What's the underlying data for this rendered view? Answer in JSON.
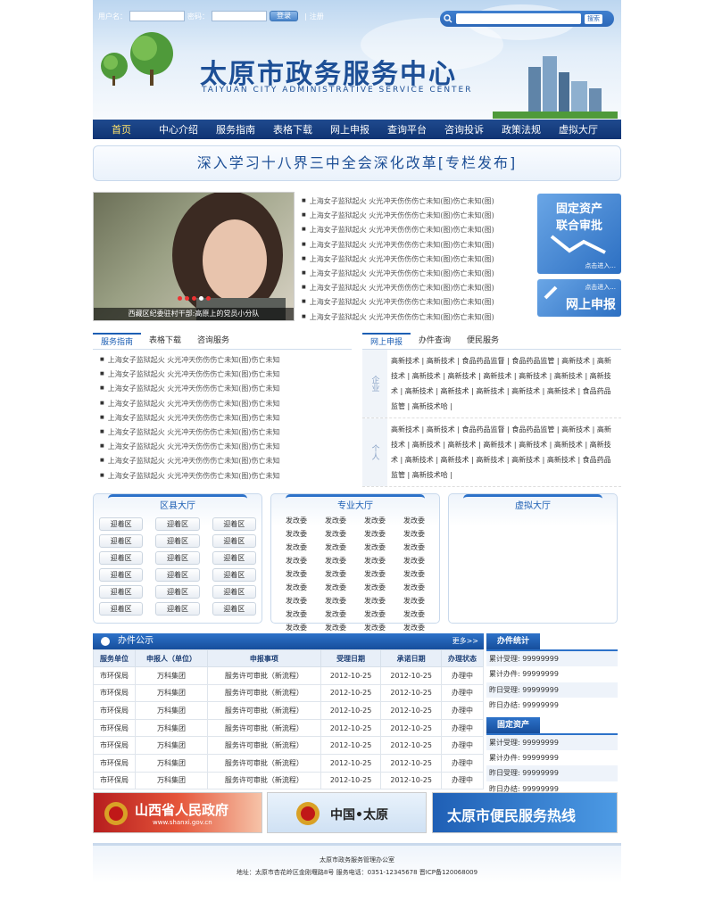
{
  "login": {
    "username_label": "用户名：",
    "password_label": "密码：",
    "login_button": "登录",
    "register_link": "注册"
  },
  "search": {
    "button": "搜索"
  },
  "site": {
    "title": "太原市政务服务中心",
    "subtitle": "TAIYUAN CITY ADMINISTRATIVE SERVICE CENTER"
  },
  "nav": [
    "首页",
    "中心介绍",
    "服务指南",
    "表格下载",
    "网上申报",
    "查询平台",
    "咨询投诉",
    "政策法规",
    "虚拟大厅"
  ],
  "banner": "深入学习十八界三中全会深化改革[专栏发布]",
  "photo_caption": "西藏区纪委驻村干部:高原上的党员小分队",
  "news_items": [
    "上海女子监狱起火 火光冲天伤伤伤亡未知(图)伤亡未知(图)",
    "上海女子监狱起火 火光冲天伤伤伤亡未知(图)伤亡未知(图)",
    "上海女子监狱起火 火光冲天伤伤伤亡未知(图)伤亡未知(图)",
    "上海女子监狱起火 火光冲天伤伤伤亡未知(图)伤亡未知(图)",
    "上海女子监狱起火 火光冲天伤伤伤亡未知(图)伤亡未知(图)",
    "上海女子监狱起火 火光冲天伤伤伤亡未知(图)伤亡未知(图)",
    "上海女子监狱起火 火光冲天伤伤伤亡未知(图)伤亡未知(图)",
    "上海女子监狱起火 火光冲天伤伤伤亡未知(图)伤亡未知(图)",
    "上海女子监狱起火 火光冲天伤伤伤亡未知(图)伤亡未知(图)"
  ],
  "side_buttons": {
    "fixed_assets_line1": "固定资产",
    "fixed_assets_line2": "联合审批",
    "fixed_enter": "点击进入...",
    "online_enter": "点击进入...",
    "online_label": "网上申报"
  },
  "guide_tabs": [
    "服务指南",
    "表格下载",
    "咨询服务"
  ],
  "guide_items": [
    "上海女子监狱起火 火光冲天伤伤伤亡未知(图)伤亡未知",
    "上海女子监狱起火 火光冲天伤伤伤亡未知(图)伤亡未知",
    "上海女子监狱起火 火光冲天伤伤伤亡未知(图)伤亡未知",
    "上海女子监狱起火 火光冲天伤伤伤亡未知(图)伤亡未知",
    "上海女子监狱起火 火光冲天伤伤伤亡未知(图)伤亡未知",
    "上海女子监狱起火 火光冲天伤伤伤亡未知(图)伤亡未知",
    "上海女子监狱起火 火光冲天伤伤伤亡未知(图)伤亡未知",
    "上海女子监狱起火 火光冲天伤伤伤亡未知(图)伤亡未知",
    "上海女子监狱起火 火光冲天伤伤伤亡未知(图)伤亡未知"
  ],
  "service_tabs": [
    "网上申报",
    "办件查询",
    "便民服务"
  ],
  "service_blocks": [
    {
      "label": "企业",
      "text": "高新技术 | 高新技术 | 食品药品监督 | 食品药品监管 | 高新技术 | 高新技术 | 高新技术 | 高新技术 | 高新技术 | 高新技术 | 高新技术 | 高新技术 | 高新技术 | 高新技术 | 高新技术 | 高新技术 | 高新技术 | 食品药品监管 | 高新技术哈 |"
    },
    {
      "label": "个人",
      "text": "高新技术 | 高新技术 | 食品药品监督 | 食品药品监管 | 高新技术 | 高新技术 | 高新技术 | 高新技术 | 高新技术 | 高新技术 | 高新技术 | 高新技术 | 高新技术 | 高新技术 | 高新技术 | 高新技术 | 高新技术 | 食品药品监管 | 高新技术哈 |"
    }
  ],
  "halls": {
    "county_title": "区县大厅",
    "county_items": [
      "迎着区",
      "迎着区",
      "迎着区",
      "迎着区",
      "迎着区",
      "迎着区",
      "迎着区",
      "迎着区",
      "迎着区",
      "迎着区",
      "迎着区",
      "迎着区",
      "迎着区",
      "迎着区",
      "迎着区",
      "迎着区",
      "迎着区",
      "迎着区"
    ],
    "pro_title": "专业大厅",
    "pro_items": [
      "发改委",
      "发改委",
      "发改委",
      "发改委",
      "发改委",
      "发改委",
      "发改委",
      "发改委",
      "发改委",
      "发改委",
      "发改委",
      "发改委",
      "发改委",
      "发改委",
      "发改委",
      "发改委",
      "发改委",
      "发改委",
      "发改委",
      "发改委",
      "发改委",
      "发改委",
      "发改委",
      "发改委",
      "发改委",
      "发改委",
      "发改委",
      "发改委",
      "发改委",
      "发改委",
      "发改委",
      "发改委",
      "发改委",
      "发改委",
      "发改委",
      "发改委"
    ],
    "virtual_title": "虚拟大厅"
  },
  "affairs": {
    "title": "办件公示",
    "more": "更多>>",
    "headers": [
      "服务单位",
      "申报人（单位）",
      "申报事项",
      "受理日期",
      "承诺日期",
      "办理状态"
    ],
    "rows": [
      [
        "市环保局",
        "万科集团",
        "服务许可审批（新流程）",
        "2012-10-25",
        "2012-10-25",
        "办理中"
      ],
      [
        "市环保局",
        "万科集团",
        "服务许可审批（新流程）",
        "2012-10-25",
        "2012-10-25",
        "办理中"
      ],
      [
        "市环保局",
        "万科集团",
        "服务许可审批（新流程）",
        "2012-10-25",
        "2012-10-25",
        "办理中"
      ],
      [
        "市环保局",
        "万科集团",
        "服务许可审批（新流程）",
        "2012-10-25",
        "2012-10-25",
        "办理中"
      ],
      [
        "市环保局",
        "万科集团",
        "服务许可审批（新流程）",
        "2012-10-25",
        "2012-10-25",
        "办理中"
      ],
      [
        "市环保局",
        "万科集团",
        "服务许可审批（新流程）",
        "2012-10-25",
        "2012-10-25",
        "办理中"
      ],
      [
        "市环保局",
        "万科集团",
        "服务许可审批（新流程）",
        "2012-10-25",
        "2012-10-25",
        "办理中"
      ]
    ]
  },
  "stats": {
    "title1": "办件统计",
    "rows1": [
      "累计受理: 99999999",
      "累计办件: 99999999",
      "昨日受理: 99999999",
      "昨日办结: 99999999"
    ],
    "title2": "固定资产",
    "rows2": [
      "累计受理: 99999999",
      "累计办件: 99999999",
      "昨日受理: 99999999",
      "昨日办结: 99999999"
    ]
  },
  "logos": {
    "shanxi": "山西省人民政府",
    "shanxi_url": "www.shanxi.gov.cn",
    "taiyuan": "中国•太原",
    "hotline": "太原市便民服务热线"
  },
  "footer": {
    "line1": "太原市政务服务管理办公室",
    "line2": "地址：太原市杏花岭区金刚堰路8号 服务电话：0351-12345678 晋ICP备120068009"
  }
}
